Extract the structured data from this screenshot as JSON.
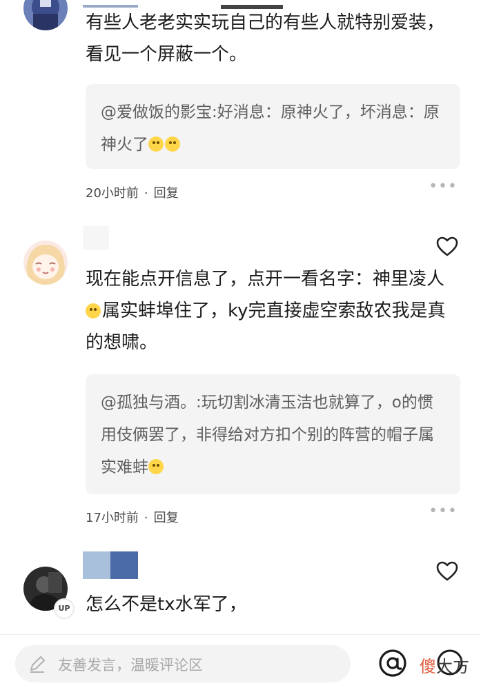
{
  "comments": [
    {
      "text": "有些人老老实实玩自己的有些人就特别爱装，看见一个屏蔽一个。",
      "quote": "@爱做饭的影宝:好消息：原神火了，坏消息：原神火了",
      "time": "20小时前",
      "reply": "回复"
    },
    {
      "text": "现在能点开信息了，点开一看名字：神里凌人",
      "text_cont": "属实蚌埠住了，ky完直接虚空索敌农我是真的想啸。",
      "quote": "@孤独与酒。:玩切割冰清玉洁也就算了，o的惯用伎俩罢了，非得给对方扣个别的阵营的帽子属实难蚌",
      "time": "17小时前",
      "reply": "回复"
    },
    {
      "text": "怎么不是tx水军了，",
      "badge": "UP"
    }
  ],
  "bottom": {
    "placeholder": "友善发言，温暖评论区",
    "watermark_1": "傻",
    "watermark_2": "大方"
  },
  "more_glyph": "•••",
  "separator": "·",
  "colors": {
    "accent": "#e05a3c",
    "quote_bg": "#f4f4f4"
  }
}
